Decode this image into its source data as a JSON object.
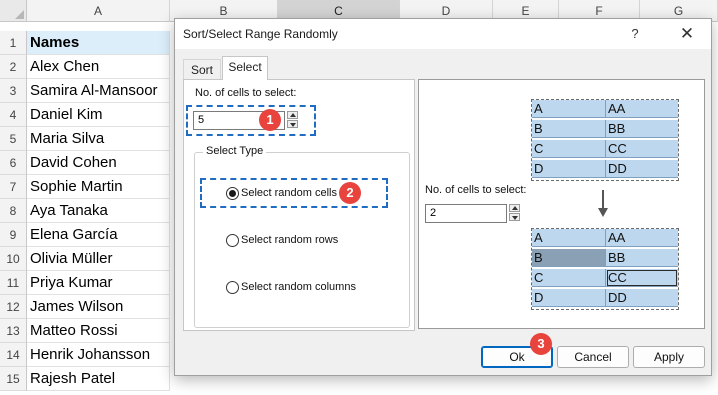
{
  "spreadsheet": {
    "columns": [
      "A",
      "B",
      "C",
      "D",
      "E",
      "F",
      "G"
    ],
    "rows": [
      "1",
      "2",
      "3",
      "4",
      "5",
      "6",
      "7",
      "8",
      "9",
      "10",
      "11",
      "12",
      "13",
      "14",
      "15"
    ],
    "cells": [
      "Names",
      "Alex Chen",
      "Samira Al-Mansoor",
      "Daniel Kim",
      "Maria Silva",
      "David Cohen",
      "Sophie Martin",
      "Aya Tanaka",
      "Elena García",
      "Olivia Müller",
      "Priya Kumar",
      "James Wilson",
      "Matteo Rossi",
      "Henrik Johansson",
      "Rajesh Patel"
    ],
    "header_fill": "#dbeefa"
  },
  "dialog": {
    "title": "Sort/Select Range Randomly",
    "help_icon": "?",
    "close_icon": "✕",
    "tabs": [
      "Sort",
      "Select"
    ],
    "active_tab": "Select",
    "cells_label": "No. of cells to select:",
    "cells_value": "5",
    "select_type_label": "Select Type",
    "options": [
      "Select random cells",
      "Select random rows",
      "Select random columns"
    ],
    "selected_option": "Select random cells",
    "preview": {
      "cells_label": "No. of cells to select:",
      "cells_value": "2",
      "before": [
        [
          "A",
          "AA"
        ],
        [
          "B",
          "BB"
        ],
        [
          "C",
          "CC"
        ],
        [
          "D",
          "DD"
        ]
      ],
      "after": [
        [
          "A",
          "AA"
        ],
        [
          "B",
          "BB"
        ],
        [
          "C",
          "CC"
        ],
        [
          "D",
          "DD"
        ]
      ],
      "cell_color": "#bdd7ee",
      "selected_cell_color": "#8aa0b5"
    },
    "buttons": {
      "ok": "Ok",
      "cancel": "Cancel",
      "apply": "Apply"
    },
    "callouts": [
      "1",
      "2",
      "3"
    ],
    "callout_color": "#e8433d",
    "highlight_color": "#1f6cc1"
  }
}
